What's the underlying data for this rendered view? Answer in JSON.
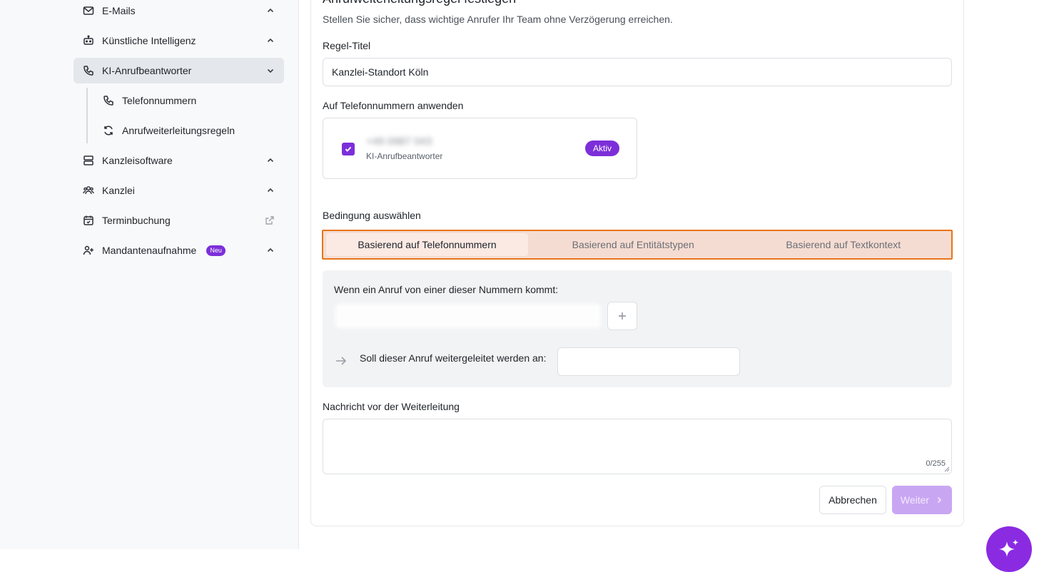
{
  "sidebar": {
    "items": [
      {
        "label": "E-Mails",
        "icon": "mail-icon"
      },
      {
        "label": "Künstliche Intelligenz",
        "icon": "robot-icon"
      },
      {
        "label": "KI-Anrufbeantworter",
        "icon": "phone-icon"
      },
      {
        "label": "Kanzleisoftware",
        "icon": "server-icon"
      },
      {
        "label": "Kanzlei",
        "icon": "users-icon"
      },
      {
        "label": "Terminbuchung",
        "icon": "calendar-icon"
      },
      {
        "label": "Mandantenaufnahme",
        "icon": "user-plus-icon",
        "badge": "Neu"
      }
    ],
    "sub_items": [
      {
        "label": "Telefonnummern",
        "icon": "phone-icon"
      },
      {
        "label": "Anrufweiterleitungsregeln",
        "icon": "refresh-icon"
      }
    ]
  },
  "form": {
    "title": "Anrufweiterleitungsregel festlegen",
    "subtitle": "Stellen Sie sicher, dass wichtige Anrufer Ihr Team ohne Verzögerung erreichen.",
    "rule_title_label": "Regel-Titel",
    "rule_title_value": "Kanzlei-Standort Köln",
    "apply_label": "Auf Telefonnummern anwenden",
    "phone_card": {
      "number": "+49 0987 043",
      "subtitle": "KI-Anrufbeantworter",
      "status": "Aktiv"
    },
    "condition_label": "Bedingung auswählen",
    "tabs": [
      {
        "label": "Basierend auf Telefonnummern",
        "active": true
      },
      {
        "label": "Basierend auf Entitätstypen",
        "active": false
      },
      {
        "label": "Basierend auf Textkontext",
        "active": false
      }
    ],
    "condition": {
      "when_label": "Wenn ein Anruf von einer dieser Nummern kommt:",
      "forward_label": "Soll dieser Anruf weitergeleitet werden an:"
    },
    "message_label": "Nachricht vor der Weiterleitung",
    "message_counter": "0/255",
    "cancel_label": "Abbrechen",
    "next_label": "Weiter"
  },
  "colors": {
    "accent": "#7c2fd9",
    "highlight_border": "#e8751a",
    "fab": "#8a2be2"
  }
}
